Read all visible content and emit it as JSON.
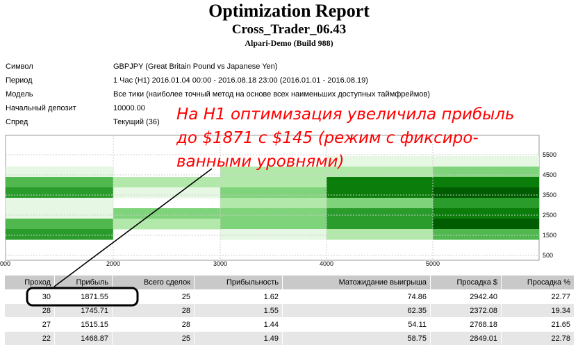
{
  "header": {
    "title": "Optimization Report",
    "subtitle": "Cross_Trader_06.43",
    "broker": "Alpari-Demo (Build 988)"
  },
  "info": [
    {
      "label": "Символ",
      "value": "GBPJPY (Great Britain Pound vs Japanese Yen)"
    },
    {
      "label": "Период",
      "value": "1 Час (H1) 2016.01.04 00:00 - 2016.08.18 23:00 (2016.01.01 - 2016.08.19)"
    },
    {
      "label": "Модель",
      "value": "Все тики (наиболее точный метод на основе всех наименьших доступных таймфреймов)"
    },
    {
      "label": "Начальный депозит",
      "value": "10000.00"
    },
    {
      "label": "Спред",
      "value": "Текущий (36)"
    }
  ],
  "heatmap": {
    "x_ticks": [
      "000",
      "2000",
      "3000",
      "4000",
      "5000"
    ],
    "y_ticks": [
      "5500",
      "4500",
      "3500",
      "2500",
      "1500",
      "500"
    ],
    "grid": true,
    "colors": [
      "#ffffff",
      "#e6f8e3",
      "#b3e8ab",
      "#7fd37a",
      "#50b84e",
      "#2a9c2c",
      "#0b7d0b",
      "#005c00"
    ]
  },
  "annotation": {
    "lines": [
      "На Н1 оптимизация увеличила прибыль",
      "до $1871 с $145 (режим с фиксиро-",
      "ванными уровнями)"
    ],
    "color": "#ff0000"
  },
  "table": {
    "headers": [
      "Проход",
      "Прибыль",
      "Всего сделок",
      "Прибыльность",
      "Матожидание выигрыша",
      "Просадка $",
      "Просадка %"
    ],
    "rows": [
      [
        "30",
        "1871.55",
        "25",
        "1.62",
        "74.86",
        "2942.40",
        "22.77"
      ],
      [
        "28",
        "1745.71",
        "28",
        "1.55",
        "62.35",
        "2372.08",
        "19.34"
      ],
      [
        "27",
        "1515.15",
        "28",
        "1.44",
        "54.11",
        "2768.18",
        "21.65"
      ],
      [
        "22",
        "1468.87",
        "25",
        "1.49",
        "58.75",
        "2849.01",
        "22.78"
      ]
    ]
  }
}
